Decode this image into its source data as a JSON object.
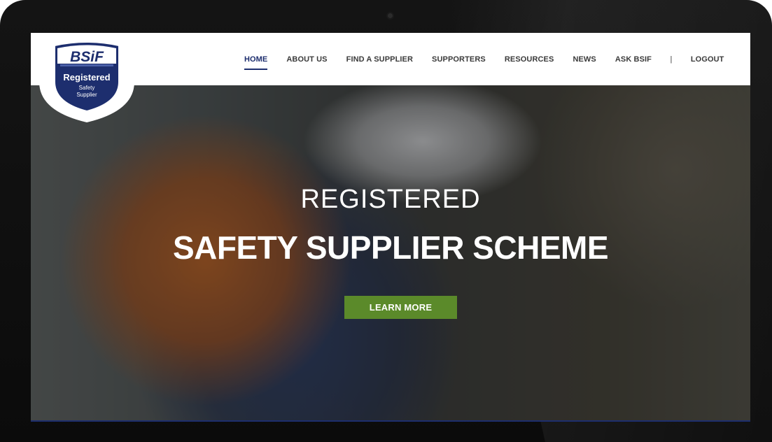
{
  "logo": {
    "brand": "BSiF",
    "line1": "Registered",
    "line2": "Safety",
    "line3": "Supplier"
  },
  "nav": {
    "items": [
      {
        "label": "HOME",
        "active": true
      },
      {
        "label": "ABOUT US"
      },
      {
        "label": "FIND A SUPPLIER"
      },
      {
        "label": "SUPPORTERS"
      },
      {
        "label": "RESOURCES"
      },
      {
        "label": "NEWS"
      },
      {
        "label": "ASK BSIF"
      }
    ],
    "separator": "|",
    "logout": "LOGOUT"
  },
  "hero": {
    "subtitle": "REGISTERED",
    "title": "SAFETY SUPPLIER SCHEME",
    "cta_label": "LEARN MORE"
  },
  "colors": {
    "brand_navy": "#1d2e6e",
    "cta_green": "#5b8a2a"
  }
}
